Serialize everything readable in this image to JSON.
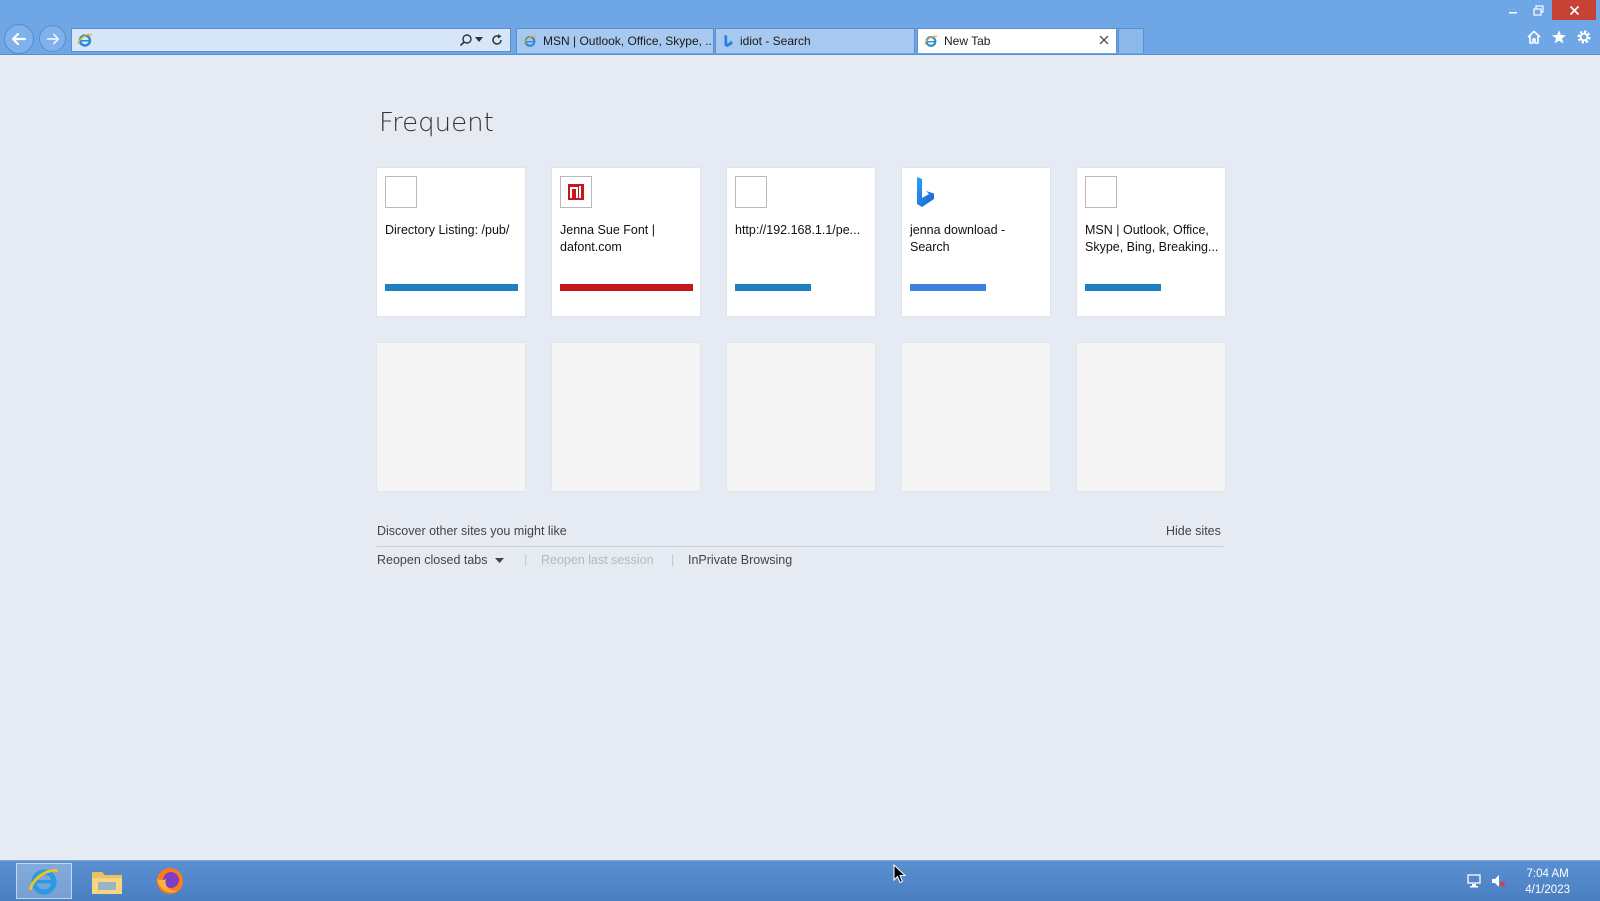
{
  "browser": {
    "address": {
      "value": "",
      "placeholder": ""
    },
    "tabs": [
      {
        "label": "MSN | Outlook, Office, Skype, ...",
        "icon": "ie-icon"
      },
      {
        "label": "idiot - Search",
        "icon": "bing-icon"
      },
      {
        "label": "New Tab",
        "icon": "ie-icon",
        "active": true
      }
    ]
  },
  "page": {
    "title": "Frequent",
    "tiles": [
      {
        "title": "Directory Listing: /pub/",
        "accent": "#1e7fc1",
        "favicon": "blank"
      },
      {
        "title": "Jenna Sue Font | dafont.com",
        "accent": "#c8161d",
        "favicon": "dafont-logo"
      },
      {
        "title": "http://192.168.1.1/pe...",
        "accent": "#1e7fc1",
        "favicon": "blank"
      },
      {
        "title": "jenna download - Search",
        "accent": "#3b82e0",
        "favicon": "bing-logo"
      },
      {
        "title": "MSN | Outlook, Office, Skype, Bing, Breaking...",
        "accent": "#1e7fc1",
        "favicon": "blank"
      }
    ],
    "discover": "Discover other sites you might like",
    "hide_sites": "Hide sites",
    "reopen_closed": "Reopen closed tabs",
    "reopen_last": "Reopen last session",
    "inprivate": "InPrivate Browsing"
  },
  "taskbar": {
    "apps": [
      "internet-explorer",
      "file-explorer",
      "firefox"
    ],
    "time": "7:04 AM",
    "date": "4/1/2023"
  }
}
